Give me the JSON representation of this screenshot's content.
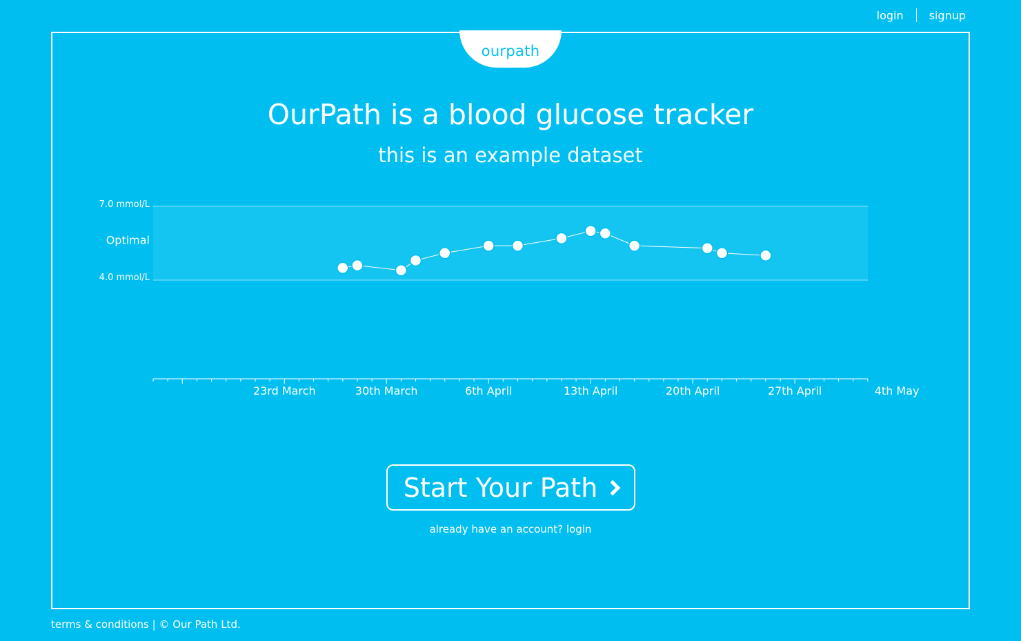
{
  "nav": {
    "login_label": "login",
    "signup_label": "signup"
  },
  "logo": {
    "text": "ourpath"
  },
  "hero": {
    "title": "OurPath is a blood glucose tracker",
    "subtitle": "this is an example dataset"
  },
  "chart_data": {
    "type": "scatter",
    "band": {
      "label": "Optimal",
      "upper_label": "7.0 mmol/L",
      "lower_label": "4.0 mmol/L",
      "upper": 7.0,
      "lower": 4.0
    },
    "x_tick_labels": [
      "23rd March",
      "30th March",
      "6th April",
      "13th April",
      "20th April",
      "27th April",
      "4th May"
    ],
    "x": [
      "2016-03-27",
      "2016-03-28",
      "2016-03-31",
      "2016-04-01",
      "2016-04-03",
      "2016-04-06",
      "2016-04-08",
      "2016-04-11",
      "2016-04-13",
      "2016-04-14",
      "2016-04-16",
      "2016-04-21",
      "2016-04-22",
      "2016-04-25"
    ],
    "values": [
      4.5,
      4.6,
      4.4,
      4.8,
      5.1,
      5.4,
      5.4,
      5.7,
      6.0,
      5.9,
      5.4,
      5.3,
      5.1,
      5.0
    ],
    "grid": false,
    "colors": {
      "background": "#00bff0",
      "band": "#14c4f1",
      "marks": "#ffffff"
    }
  },
  "cta": {
    "button_label": "Start Your Path",
    "account_prompt": "already have an account?",
    "account_login": "login"
  },
  "footer": {
    "terms": "terms & conditions",
    "separator": "|",
    "copyright": "© Our Path Ltd."
  }
}
